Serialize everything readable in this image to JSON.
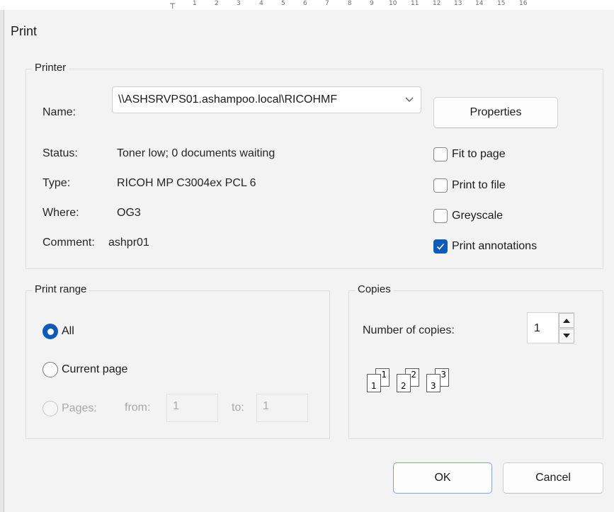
{
  "host": {
    "ruler_ticks": [
      "1",
      "2",
      "3",
      "4",
      "5",
      "6",
      "7",
      "8",
      "9",
      "10",
      "11",
      "12",
      "13",
      "14",
      "15",
      "16"
    ]
  },
  "dialog": {
    "title": "Print",
    "printer": {
      "group_label": "Printer",
      "name_label": "Name:",
      "name_value": "\\\\ASHSRVPS01.ashampoo.local\\RICOHMF",
      "properties_label": "Properties",
      "status_label": "Status:",
      "status_value": "Toner low; 0 documents waiting",
      "type_label": "Type:",
      "type_value": "RICOH MP C3004ex PCL 6",
      "where_label": "Where:",
      "where_value": "OG3",
      "comment_label": "Comment:",
      "comment_value": "ashpr01",
      "options": [
        {
          "label": "Fit to page",
          "checked": false
        },
        {
          "label": "Print to file",
          "checked": false
        },
        {
          "label": "Greyscale",
          "checked": false
        },
        {
          "label": "Print annotations",
          "checked": true
        }
      ]
    },
    "print_range": {
      "group_label": "Print range",
      "all_label": "All",
      "current_page_label": "Current page",
      "pages_label": "Pages:",
      "from_label": "from:",
      "from_value": "1",
      "to_label": "to:",
      "to_value": "1",
      "selected": "All"
    },
    "copies": {
      "group_label": "Copies",
      "number_label": "Number of copies:",
      "number_value": "1",
      "collate_pages": [
        "1",
        "2",
        "3"
      ]
    },
    "buttons": {
      "ok_label": "OK",
      "cancel_label": "Cancel"
    },
    "colors": {
      "accent": "#0f5cb8",
      "background": "#f3f3f3"
    },
    "icons": {
      "dropdown": "chevron-down-icon",
      "checkmark": "checkmark-icon",
      "spin_up": "spin-up-icon",
      "spin_down": "spin-down-icon"
    }
  }
}
